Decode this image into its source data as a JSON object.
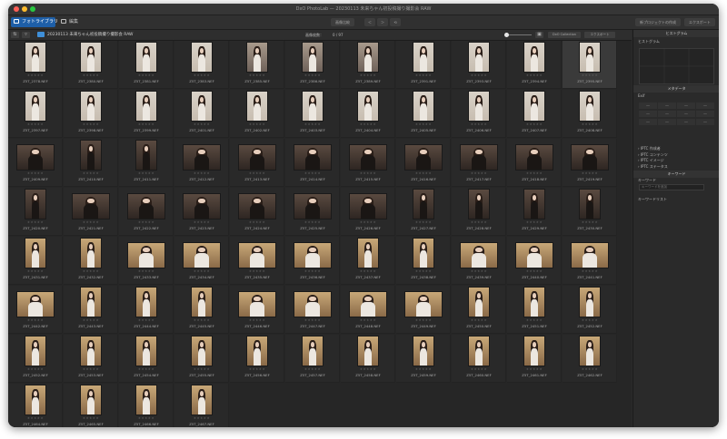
{
  "window": {
    "title": "DxO PhotoLab — 20230113 未来ちゃん初投稿撮り撮影会 RAW"
  },
  "toolbar": {
    "tabs": [
      {
        "label": "フォトライブラリ",
        "active": true
      },
      {
        "label": "編集",
        "active": false
      }
    ],
    "center_buttons": [
      "画像比較",
      "＜",
      "＞",
      "⟲"
    ],
    "right_buttons": [
      "新プロジェクトの作成",
      "エクスポート"
    ]
  },
  "pathbar": {
    "path": "20230113 未来ちゃん初投稿撮り撮影会 RAW",
    "count_label": "画像枚数：",
    "count_value": "0 / 97",
    "collection_button": "DxO Collection",
    "export_button": "エクスポート"
  },
  "rating_glyphs": "★★★★★",
  "photos": [
    {
      "name": "Z5T_2378.NEF",
      "o": "p",
      "s": "w"
    },
    {
      "name": "Z5T_2380.NEF",
      "o": "p",
      "s": "w"
    },
    {
      "name": "Z5T_2381.NEF",
      "o": "p",
      "s": "w"
    },
    {
      "name": "Z5T_2383.NEF",
      "o": "p",
      "s": "w"
    },
    {
      "name": "Z5T_2385.NEF",
      "o": "p",
      "s": "h"
    },
    {
      "name": "Z5T_2386.NEF",
      "o": "p",
      "s": "h"
    },
    {
      "name": "Z5T_2389.NEF",
      "o": "p",
      "s": "h"
    },
    {
      "name": "Z5T_2391.NEF",
      "o": "p",
      "s": "w"
    },
    {
      "name": "Z5T_2393.NEF",
      "o": "p",
      "s": "w"
    },
    {
      "name": "Z5T_2394.NEF",
      "o": "p",
      "s": "w"
    },
    {
      "name": "Z5T_2395.NEF",
      "o": "p",
      "s": "w"
    },
    {
      "name": "Z5T_2397.NEF",
      "o": "p",
      "s": "w"
    },
    {
      "name": "Z5T_2398.NEF",
      "o": "p",
      "s": "w"
    },
    {
      "name": "Z5T_2399.NEF",
      "o": "p",
      "s": "w"
    },
    {
      "name": "Z5T_2401.NEF",
      "o": "p",
      "s": "w"
    },
    {
      "name": "Z5T_2402.NEF",
      "o": "p",
      "s": "w"
    },
    {
      "name": "Z5T_2403.NEF",
      "o": "p",
      "s": "w"
    },
    {
      "name": "Z5T_2404.NEF",
      "o": "p",
      "s": "w"
    },
    {
      "name": "Z5T_2405.NEF",
      "o": "p",
      "s": "w"
    },
    {
      "name": "Z5T_2406.NEF",
      "o": "p",
      "s": "w"
    },
    {
      "name": "Z5T_2407.NEF",
      "o": "p",
      "s": "w"
    },
    {
      "name": "Z5T_2408.NEF",
      "o": "p",
      "s": "w"
    },
    {
      "name": "Z5T_2409.NEF",
      "o": "l",
      "s": "d"
    },
    {
      "name": "Z5T_2410.NEF",
      "o": "p",
      "s": "d"
    },
    {
      "name": "Z5T_2411.NEF",
      "o": "p",
      "s": "d"
    },
    {
      "name": "Z5T_2412.NEF",
      "o": "l",
      "s": "d"
    },
    {
      "name": "Z5T_2413.NEF",
      "o": "l",
      "s": "d"
    },
    {
      "name": "Z5T_2414.NEF",
      "o": "l",
      "s": "d"
    },
    {
      "name": "Z5T_2415.NEF",
      "o": "l",
      "s": "d"
    },
    {
      "name": "Z5T_2416.NEF",
      "o": "l",
      "s": "d"
    },
    {
      "name": "Z5T_2417.NEF",
      "o": "l",
      "s": "d"
    },
    {
      "name": "Z5T_2418.NEF",
      "o": "l",
      "s": "d"
    },
    {
      "name": "Z5T_2419.NEF",
      "o": "l",
      "s": "d"
    },
    {
      "name": "Z5T_2420.NEF",
      "o": "p",
      "s": "d"
    },
    {
      "name": "Z5T_2421.NEF",
      "o": "l",
      "s": "d"
    },
    {
      "name": "Z5T_2422.NEF",
      "o": "l",
      "s": "d"
    },
    {
      "name": "Z5T_2423.NEF",
      "o": "l",
      "s": "d"
    },
    {
      "name": "Z5T_2424.NEF",
      "o": "l",
      "s": "d"
    },
    {
      "name": "Z5T_2425.NEF",
      "o": "l",
      "s": "d"
    },
    {
      "name": "Z5T_2426.NEF",
      "o": "l",
      "s": "d"
    },
    {
      "name": "Z5T_2427.NEF",
      "o": "p",
      "s": "d"
    },
    {
      "name": "Z5T_2428.NEF",
      "o": "p",
      "s": "d"
    },
    {
      "name": "Z5T_2429.NEF",
      "o": "p",
      "s": "d"
    },
    {
      "name": "Z5T_2430.NEF",
      "o": "p",
      "s": "d"
    },
    {
      "name": "Z5T_2431.NEF",
      "o": "p",
      "s": "c"
    },
    {
      "name": "Z5T_2432.NEF",
      "o": "p",
      "s": "c"
    },
    {
      "name": "Z5T_2433.NEF",
      "o": "l",
      "s": "c"
    },
    {
      "name": "Z5T_2434.NEF",
      "o": "l",
      "s": "c"
    },
    {
      "name": "Z5T_2435.NEF",
      "o": "l",
      "s": "c"
    },
    {
      "name": "Z5T_2436.NEF",
      "o": "l",
      "s": "c"
    },
    {
      "name": "Z5T_2437.NEF",
      "o": "p",
      "s": "c"
    },
    {
      "name": "Z5T_2438.NEF",
      "o": "p",
      "s": "c"
    },
    {
      "name": "Z5T_2439.NEF",
      "o": "l",
      "s": "c"
    },
    {
      "name": "Z5T_2440.NEF",
      "o": "l",
      "s": "c"
    },
    {
      "name": "Z5T_2441.NEF",
      "o": "l",
      "s": "c"
    },
    {
      "name": "Z5T_2442.NEF",
      "o": "l",
      "s": "c"
    },
    {
      "name": "Z5T_2443.NEF",
      "o": "p",
      "s": "c"
    },
    {
      "name": "Z5T_2444.NEF",
      "o": "p",
      "s": "c"
    },
    {
      "name": "Z5T_2445.NEF",
      "o": "p",
      "s": "c"
    },
    {
      "name": "Z5T_2446.NEF",
      "o": "l",
      "s": "c"
    },
    {
      "name": "Z5T_2447.NEF",
      "o": "l",
      "s": "c"
    },
    {
      "name": "Z5T_2448.NEF",
      "o": "l",
      "s": "c"
    },
    {
      "name": "Z5T_2449.NEF",
      "o": "l",
      "s": "c"
    },
    {
      "name": "Z5T_2450.NEF",
      "o": "p",
      "s": "c"
    },
    {
      "name": "Z5T_2451.NEF",
      "o": "p",
      "s": "c"
    },
    {
      "name": "Z5T_2452.NEF",
      "o": "p",
      "s": "c"
    },
    {
      "name": "Z5T_2452.NEF",
      "o": "p",
      "s": "c"
    },
    {
      "name": "Z5T_2453.NEF",
      "o": "p",
      "s": "c"
    },
    {
      "name": "Z5T_2454.NEF",
      "o": "p",
      "s": "c"
    },
    {
      "name": "Z5T_2455.NEF",
      "o": "p",
      "s": "c"
    },
    {
      "name": "Z5T_2456.NEF",
      "o": "p",
      "s": "c"
    },
    {
      "name": "Z5T_2457.NEF",
      "o": "p",
      "s": "c"
    },
    {
      "name": "Z5T_2458.NEF",
      "o": "p",
      "s": "c"
    },
    {
      "name": "Z5T_2459.NEF",
      "o": "p",
      "s": "c"
    },
    {
      "name": "Z5T_2460.NEF",
      "o": "p",
      "s": "c"
    },
    {
      "name": "Z5T_2461.NEF",
      "o": "p",
      "s": "c"
    },
    {
      "name": "Z5T_2462.NEF",
      "o": "p",
      "s": "c"
    },
    {
      "name": "Z5T_2464.NEF",
      "o": "p",
      "s": "c"
    },
    {
      "name": "Z5T_2465.NEF",
      "o": "p",
      "s": "c"
    },
    {
      "name": "Z5T_2466.NEF",
      "o": "p",
      "s": "c"
    },
    {
      "name": "Z5T_2467.NEF",
      "o": "p",
      "s": "c"
    }
  ],
  "palette": {
    "histogram": {
      "header": "ヒストグラム",
      "sub": "ヒストグラム"
    },
    "metadata": {
      "header": "メタデータ",
      "exif": "Exif",
      "exif_cells": [
        "—",
        "—",
        "—",
        "—",
        "—",
        "—",
        "—",
        "—",
        "—",
        "—",
        "—",
        "—"
      ]
    },
    "iptc": [
      "IPTC 作成者",
      "IPTC コンテンツ",
      "IPTC イメージ",
      "IPTC ステータス"
    ],
    "keywords": {
      "header": "キーワード",
      "sub": "キーワード",
      "placeholder": "キーワードを追加",
      "list": "キーワードリスト"
    }
  }
}
